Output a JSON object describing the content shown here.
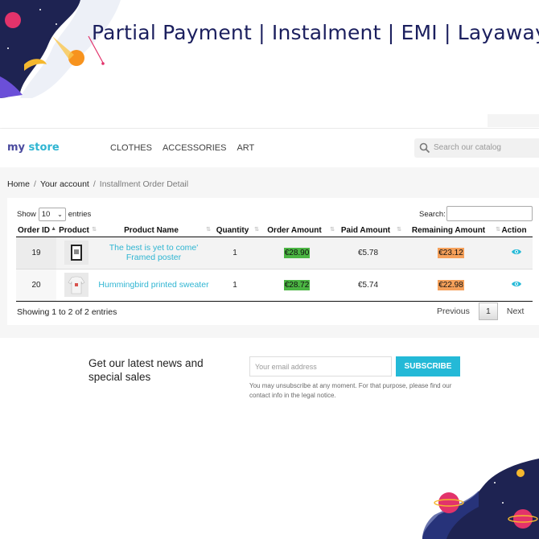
{
  "banner": {
    "title": "Partial Payment | Instalment | EMI | Layaway"
  },
  "logo": {
    "my": "my",
    "store": " store"
  },
  "nav": {
    "items": [
      "CLOTHES",
      "ACCESSORIES",
      "ART"
    ]
  },
  "search": {
    "placeholder": "Search our catalog"
  },
  "breadcrumb": {
    "home": "Home",
    "account": "Your account",
    "current": "Installment Order Detail"
  },
  "table_controls": {
    "show_label": "Show",
    "entries_value": "10",
    "entries_label": "entries",
    "search_label": "Search:"
  },
  "table": {
    "headers": [
      "Order ID",
      "Product",
      "Product Name",
      "Quantity",
      "Order Amount",
      "Paid Amount",
      "Remaining Amount",
      "Action"
    ],
    "rows": [
      {
        "order_id": "19",
        "product_name": "The best is yet to come' Framed poster",
        "quantity": "1",
        "order_amount": "€28.90",
        "paid_amount": "€5.78",
        "remaining_amount": "€23.12"
      },
      {
        "order_id": "20",
        "product_name": "Hummingbird printed sweater",
        "quantity": "1",
        "order_amount": "€28.72",
        "paid_amount": "€5.74",
        "remaining_amount": "€22.98"
      }
    ]
  },
  "pagination": {
    "info": "Showing 1 to 2 of 2 entries",
    "previous": "Previous",
    "page": "1",
    "next": "Next"
  },
  "newsletter": {
    "title": "Get our latest news and special sales",
    "placeholder": "Your email address",
    "button": "SUBSCRIBE",
    "note": "You may unsubscribe at any moment. For that purpose, please find our contact info in the legal notice."
  },
  "colors": {
    "accent": "#2fb5d2",
    "order_amount_bg": "#4bb543",
    "remaining_bg": "#f5a05a",
    "banner_text": "#1b1f5e"
  }
}
